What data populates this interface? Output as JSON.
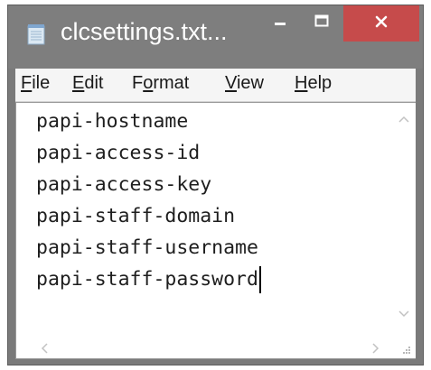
{
  "window": {
    "title": "clcsettings.txt...",
    "app_icon": "notepad-icon",
    "controls": {
      "minimize_icon": "minimize-icon",
      "maximize_icon": "maximize-icon",
      "close_icon": "close-icon"
    },
    "colors": {
      "titlebar": "#7e7e7e",
      "close": "#c64b4b"
    }
  },
  "menubar": {
    "items": [
      {
        "label": "File",
        "access_key": "F",
        "rest": "ile"
      },
      {
        "label": "Edit",
        "access_key": "E",
        "rest": "dit"
      },
      {
        "label": "Format",
        "access_key_prefix": "F",
        "access_key": "o",
        "rest": "rmat"
      },
      {
        "label": "View",
        "access_key": "V",
        "rest": "iew"
      },
      {
        "label": "Help",
        "access_key": "H",
        "rest": "elp"
      }
    ]
  },
  "editor": {
    "lines": [
      "papi-hostname",
      "papi-access-id",
      "papi-access-key",
      "papi-staff-domain",
      "papi-staff-username",
      "papi-staff-password"
    ],
    "scroll_icons": {
      "up": "chevron-up-icon",
      "down": "chevron-down-icon",
      "left": "chevron-left-icon",
      "right": "chevron-right-icon",
      "grip": "resize-grip-icon"
    }
  }
}
